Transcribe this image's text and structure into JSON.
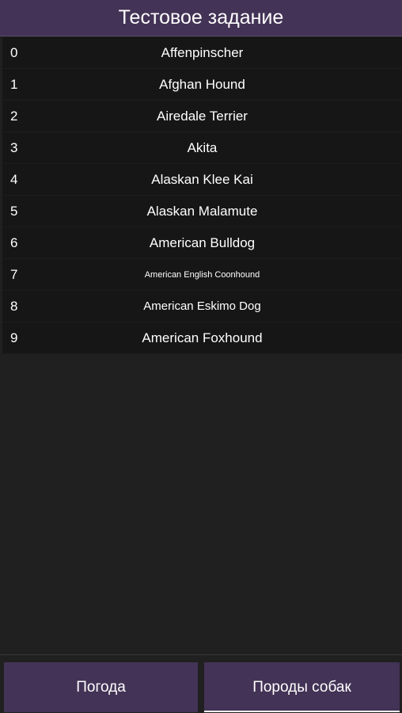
{
  "header": {
    "title": "Тестовое задание"
  },
  "breeds": [
    {
      "index": "0",
      "name": "Affenpinscher"
    },
    {
      "index": "1",
      "name": "Afghan Hound"
    },
    {
      "index": "2",
      "name": "Airedale Terrier"
    },
    {
      "index": "3",
      "name": "Akita"
    },
    {
      "index": "4",
      "name": "Alaskan Klee Kai"
    },
    {
      "index": "5",
      "name": "Alaskan Malamute"
    },
    {
      "index": "6",
      "name": "American Bulldog"
    },
    {
      "index": "7",
      "name": "American English Coonhound"
    },
    {
      "index": "8",
      "name": "American Eskimo Dog"
    },
    {
      "index": "9",
      "name": "American Foxhound"
    }
  ],
  "nav": {
    "weather_label": "Погода",
    "breeds_label": "Породы собак",
    "active": "breeds"
  },
  "colors": {
    "accent": "#433356",
    "background": "#202020",
    "row": "#161616"
  }
}
